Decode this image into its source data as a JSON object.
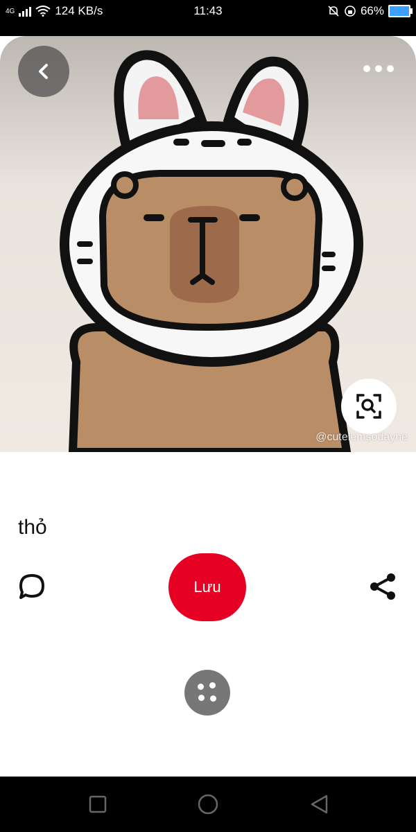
{
  "status_bar": {
    "network": "4G",
    "speed": "124 KB/s",
    "time": "11:43",
    "battery": "66%"
  },
  "pin": {
    "title": "thỏ",
    "watermark": "@cutelemsodayne",
    "save_label": "Lưu"
  },
  "icons": {
    "back": "chevron-left-icon",
    "more": "more-horizontal-icon",
    "visual_search": "lens-search-icon",
    "comment": "comment-icon",
    "share": "share-icon",
    "more_ideas": "more-ideas-icon"
  },
  "colors": {
    "accent": "#e60023",
    "background": "#ffffff",
    "navbar": "#000000"
  }
}
